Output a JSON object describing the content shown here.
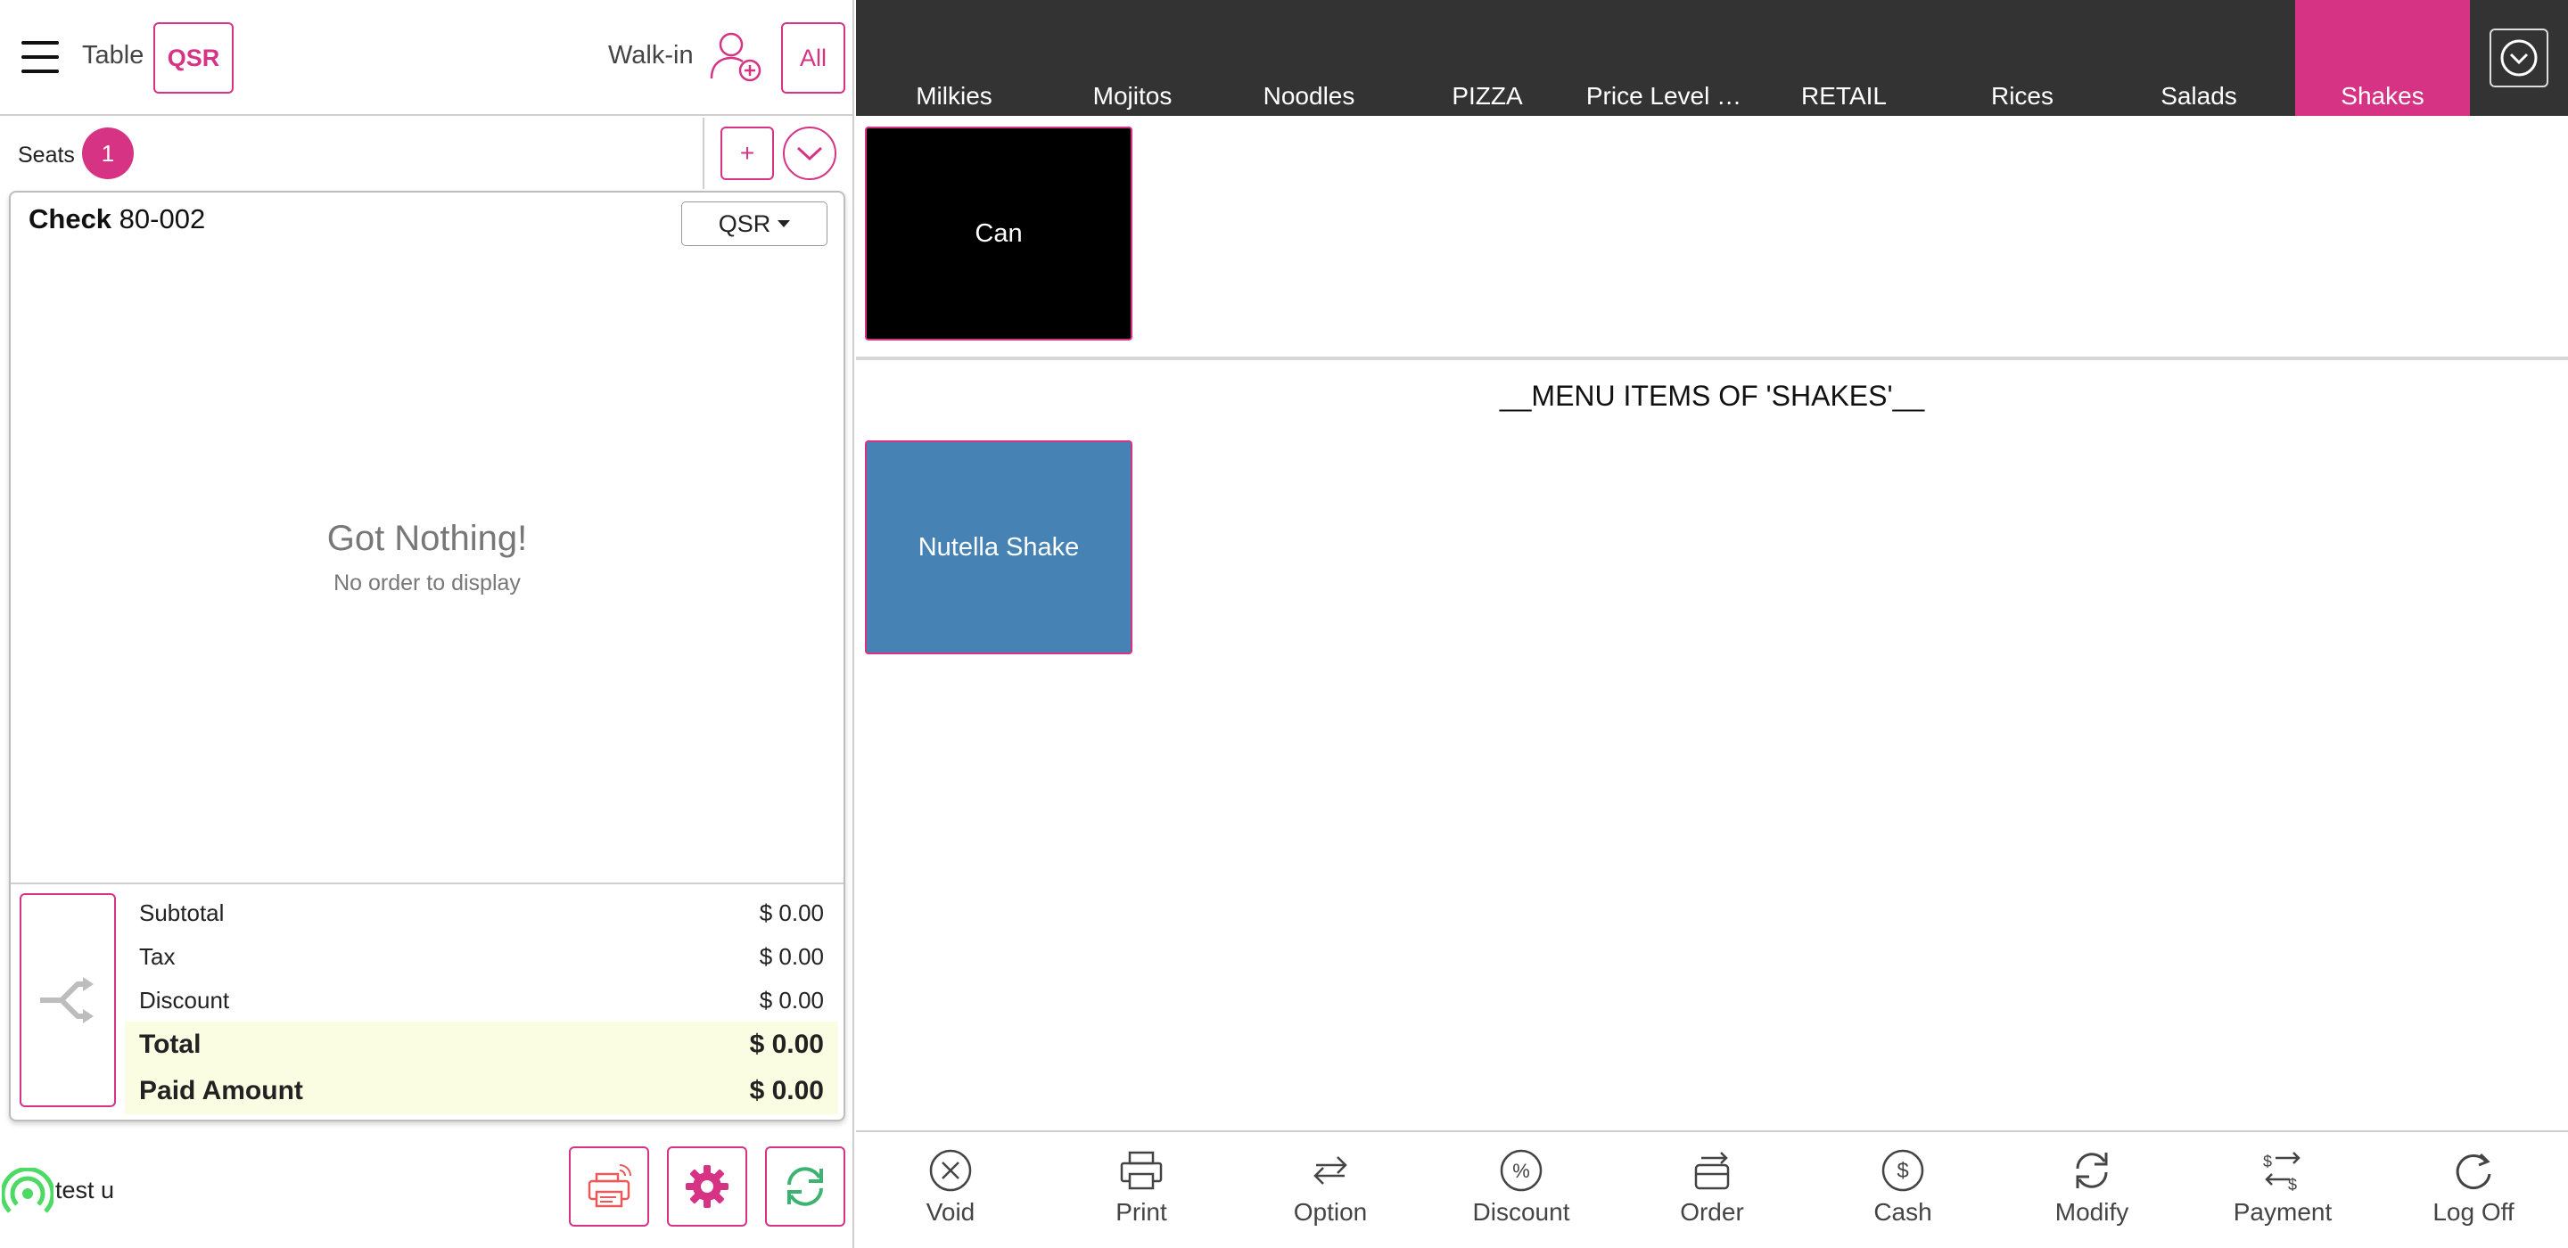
{
  "header": {
    "table_label": "Table",
    "mode_button": "QSR",
    "walkin_label": "Walk-in",
    "all_button": "All"
  },
  "seats": {
    "label": "Seats",
    "count": "1",
    "add_label": "+"
  },
  "check": {
    "title_bold": "Check",
    "number": "80-002",
    "order_type": "QSR",
    "empty_title": "Got Nothing!",
    "empty_subtitle": "No order to display"
  },
  "totals": {
    "subtotal_label": "Subtotal",
    "subtotal_value": "$ 0.00",
    "tax_label": "Tax",
    "tax_value": "$ 0.00",
    "discount_label": "Discount",
    "discount_value": "$ 0.00",
    "total_label": "Total",
    "total_value": "$ 0.00",
    "paid_label": "Paid Amount",
    "paid_value": "$ 0.00"
  },
  "status": {
    "user": "test u"
  },
  "categories": [
    {
      "label": "Milkies",
      "active": false
    },
    {
      "label": "Mojitos",
      "active": false
    },
    {
      "label": "Noodles",
      "active": false
    },
    {
      "label": "PIZZA",
      "active": false
    },
    {
      "label": "Price Level …",
      "active": false
    },
    {
      "label": "RETAIL",
      "active": false
    },
    {
      "label": "Rices",
      "active": false
    },
    {
      "label": "Salads",
      "active": false
    },
    {
      "label": "Shakes",
      "active": true
    }
  ],
  "subgroups": [
    {
      "label": "Can",
      "color": "#000000"
    }
  ],
  "menu_section_title": "__MENU ITEMS OF 'SHAKES'__",
  "menu_items": [
    {
      "label": "Nutella Shake",
      "color": "#4682b4"
    }
  ],
  "actions": {
    "void": "Void",
    "print": "Print",
    "option": "Option",
    "discount": "Discount",
    "order": "Order",
    "cash": "Cash",
    "modify": "Modify",
    "payment": "Payment",
    "logoff": "Log Off"
  },
  "colors": {
    "accent": "#d63384",
    "category_bar": "#333333",
    "highlight_row": "#fbfde3",
    "online": "#4cd964",
    "sync": "#3cb371"
  }
}
